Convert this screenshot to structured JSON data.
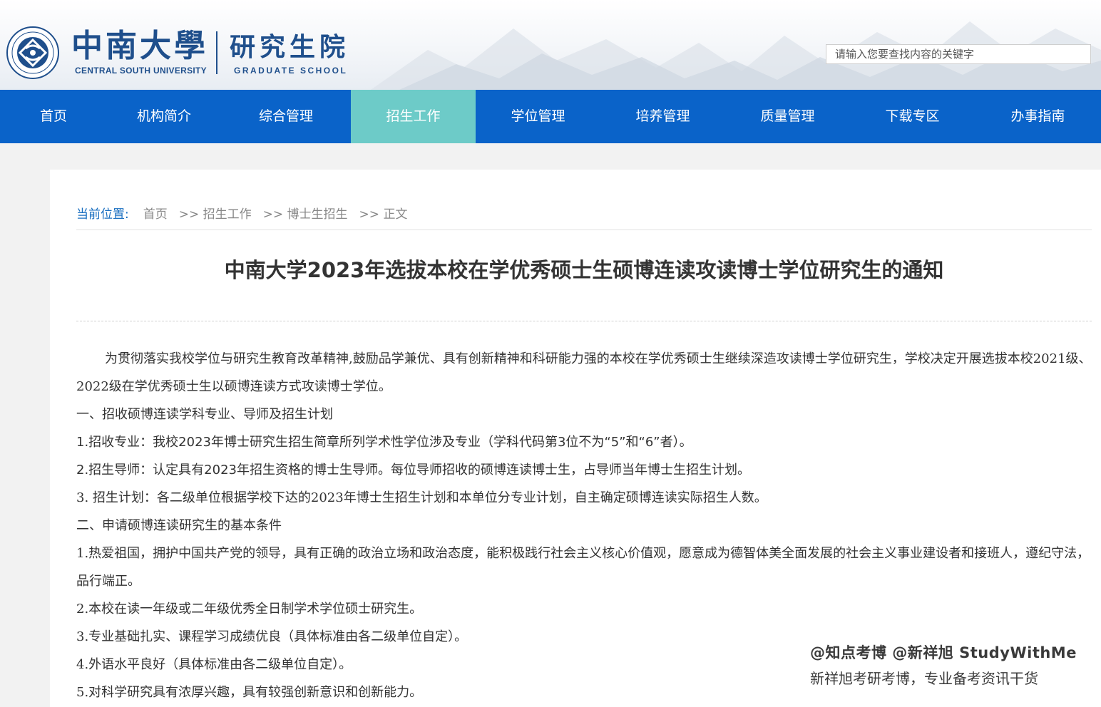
{
  "header": {
    "university_cn": "中南大學",
    "university_en": "CENTRAL SOUTH UNIVERSITY",
    "school_cn": "研究生院",
    "school_en": "GRADUATE SCHOOL",
    "search_placeholder": "请输入您要查找内容的关键字",
    "search_value": ""
  },
  "nav": {
    "items": [
      {
        "label": "首页"
      },
      {
        "label": "机构简介"
      },
      {
        "label": "综合管理"
      },
      {
        "label": "招生工作"
      },
      {
        "label": "学位管理"
      },
      {
        "label": "培养管理"
      },
      {
        "label": "质量管理"
      },
      {
        "label": "下载专区"
      },
      {
        "label": "办事指南"
      }
    ],
    "active_index": 3
  },
  "breadcrumb": {
    "label": "当前位置:",
    "items": [
      "首页",
      ">> 招生工作",
      ">> 博士生招生",
      ">> 正文"
    ]
  },
  "article": {
    "title": "中南大学2023年选拔本校在学优秀硕士生硕博连读攻读博士学位研究生的通知",
    "paragraphs": [
      "为贯彻落实我校学位与研究生教育改革精神,鼓励品学兼优、具有创新精神和科研能力强的本校在学优秀硕士生继续深造攻读博士学位研究生，学校决定开展选拔本校2021级、2022级在学优秀硕士生以硕博连读方式攻读博士学位。",
      "一、招收硕博连读学科专业、导师及招生计划",
      "1.招收专业：我校2023年博士研究生招生简章所列学术性学位涉及专业（学科代码第3位不为“5”和“6”者）。",
      "2.招生导师：认定具有2023年招生资格的博士生导师。每位导师招收的硕博连读博士生，占导师当年博士生招生计划。",
      "3. 招生计划：各二级单位根据学校下达的2023年博士生招生计划和本单位分专业计划，自主确定硕博连读实际招生人数。",
      "二、申请硕博连读研究生的基本条件",
      "1.热爱祖国，拥护中国共产党的领导，具有正确的政治立场和政治态度，能积极践行社会主义核心价值观，愿意成为德智体美全面发展的社会主义事业建设者和接班人，遵纪守法，品行端正。",
      "2.本校在读一年级或二年级优秀全日制学术学位硕士研究生。",
      "3.专业基础扎实、课程学习成绩优良（具体标准由各二级单位自定）。",
      "4.外语水平良好（具体标准由各二级单位自定）。",
      "5.对科学研究具有浓厚兴趣，具有较强创新意识和创新能力。"
    ]
  },
  "watermark": {
    "line1": "@知点考博  @新祥旭 StudyWithMe",
    "line2": "新祥旭考研考博，专业备考资讯干货"
  },
  "colors": {
    "nav_bg": "#0a63c9",
    "nav_active": "#6dcbc8",
    "brand": "#1f4f8c",
    "breadcrumb_label": "#1a6fc0"
  },
  "icons": {
    "logo": "university-emblem-icon"
  }
}
